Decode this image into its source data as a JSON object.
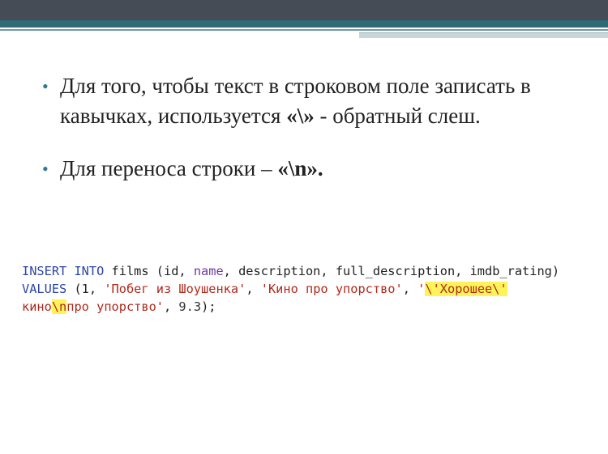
{
  "bullets": [
    {
      "text_before": "Для того, чтобы текст в строковом поле записать в кавычках, используется ",
      "bold": "«\\»",
      "text_after": " - обратный слеш."
    },
    {
      "text_before": "Для переноса строки – ",
      "bold": "«\\n».",
      "text_after": ""
    }
  ],
  "code": {
    "l1_insert": "INSERT INTO",
    "l1_films": " films (id, ",
    "l1_name": "name",
    "l1_rest": ", description, full_description, imdb_rating)",
    "l2_values": "VALUES",
    "l2_open": " (1, ",
    "l2_s1": "'Побег из Шоушенка'",
    "l2_sep1": ", ",
    "l2_s2": "'Кино про упорство'",
    "l2_sep2": ", ",
    "l2_s3a": "'",
    "l2_s3b": "\\'Хорошее\\'",
    "l3_s3c": "кино",
    "l3_s3d": "\\n",
    "l3_s3e": "про упорство'",
    "l3_sep": ", ",
    "l3_num": "9.3",
    "l3_end": ");"
  }
}
